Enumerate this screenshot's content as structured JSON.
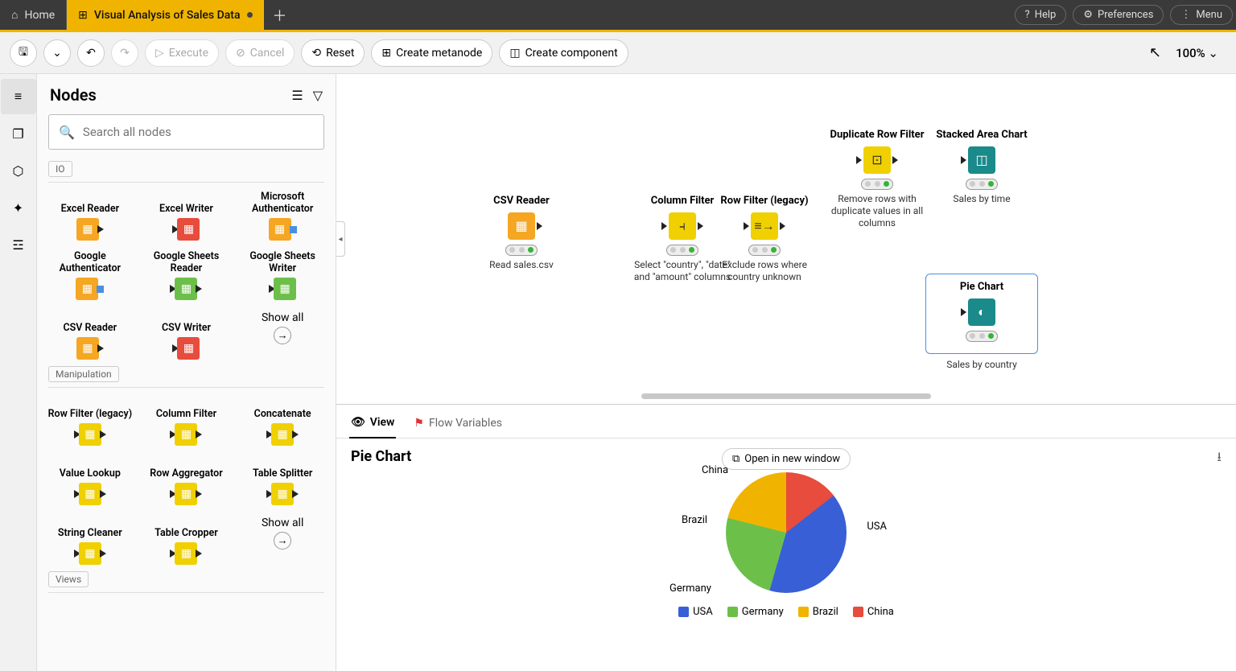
{
  "tabs": {
    "home": "Home",
    "active": "Visual Analysis of Sales Data"
  },
  "topright": {
    "help": "Help",
    "prefs": "Preferences",
    "menu": "Menu"
  },
  "toolbar": {
    "execute": "Execute",
    "cancel": "Cancel",
    "reset": "Reset",
    "metanode": "Create metanode",
    "component": "Create component",
    "zoom": "100%"
  },
  "panel": {
    "title": "Nodes",
    "search_ph": "Search all nodes",
    "cat_io": "IO",
    "cat_manip": "Manipulation",
    "cat_views": "Views",
    "io": [
      "Excel Reader",
      "Excel Writer",
      "Microsoft Authenticator",
      "Google Authenticator",
      "Google Sheets Reader",
      "Google Sheets Writer",
      "CSV Reader",
      "CSV Writer"
    ],
    "manip": [
      "Row Filter (legacy)",
      "Column Filter",
      "Concatenate",
      "Value Lookup",
      "Row Aggregator",
      "Table Splitter",
      "String Cleaner",
      "Table Cropper"
    ],
    "showall": "Show all"
  },
  "workflow": {
    "csv": {
      "title": "CSV Reader",
      "sub": "Read sales.csv"
    },
    "colf": {
      "title": "Column Filter",
      "sub": "Select \"country\", \"date\" and \"amount\" columns"
    },
    "rowf": {
      "title": "Row Filter (legacy)",
      "sub": "Exclude rows where country unknown"
    },
    "dup": {
      "title": "Duplicate Row Filter",
      "sub": "Remove rows with duplicate values in all columns"
    },
    "area": {
      "title": "Stacked Area Chart",
      "sub": "Sales by time"
    },
    "pie": {
      "title": "Pie Chart",
      "sub": "Sales by country"
    }
  },
  "view": {
    "tab_view": "View",
    "tab_flow": "Flow Variables",
    "title": "Pie Chart",
    "open": "Open in new window",
    "labels": {
      "usa": "USA",
      "germany": "Germany",
      "brazil": "Brazil",
      "china": "China"
    }
  },
  "chart_data": {
    "type": "pie",
    "title": "Pie Chart",
    "series": [
      {
        "name": "USA",
        "value": 40,
        "color": "#395fd6"
      },
      {
        "name": "Germany",
        "value": 24,
        "color": "#6cc04a"
      },
      {
        "name": "Brazil",
        "value": 21,
        "color": "#f0b400"
      },
      {
        "name": "China",
        "value": 15,
        "color": "#e74c3c"
      }
    ]
  }
}
